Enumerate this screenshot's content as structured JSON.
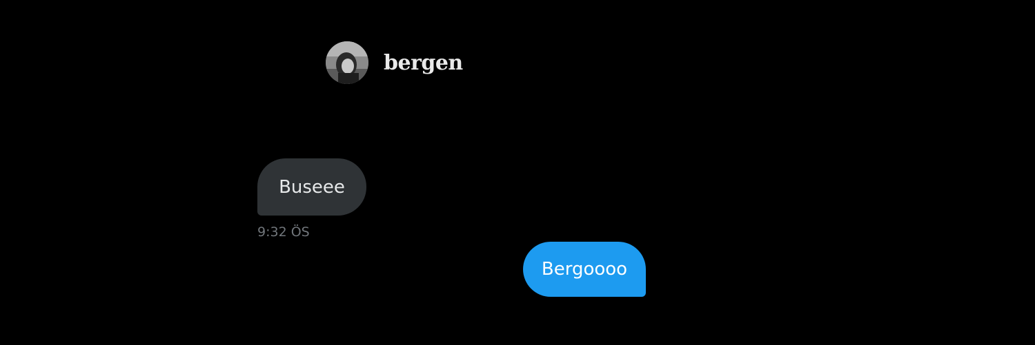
{
  "conversation": {
    "contact_name": "bergen",
    "avatar_icon": "profile-photo"
  },
  "messages": [
    {
      "direction": "incoming",
      "text": "Buseee",
      "time": "9:32 ÖS"
    },
    {
      "direction": "outgoing",
      "text": "Bergoooo"
    }
  ],
  "colors": {
    "background": "#000000",
    "incoming_bubble": "#2f3336",
    "outgoing_bubble": "#1d9bf0",
    "timestamp": "#71767b",
    "name": "#e9e9e9"
  }
}
